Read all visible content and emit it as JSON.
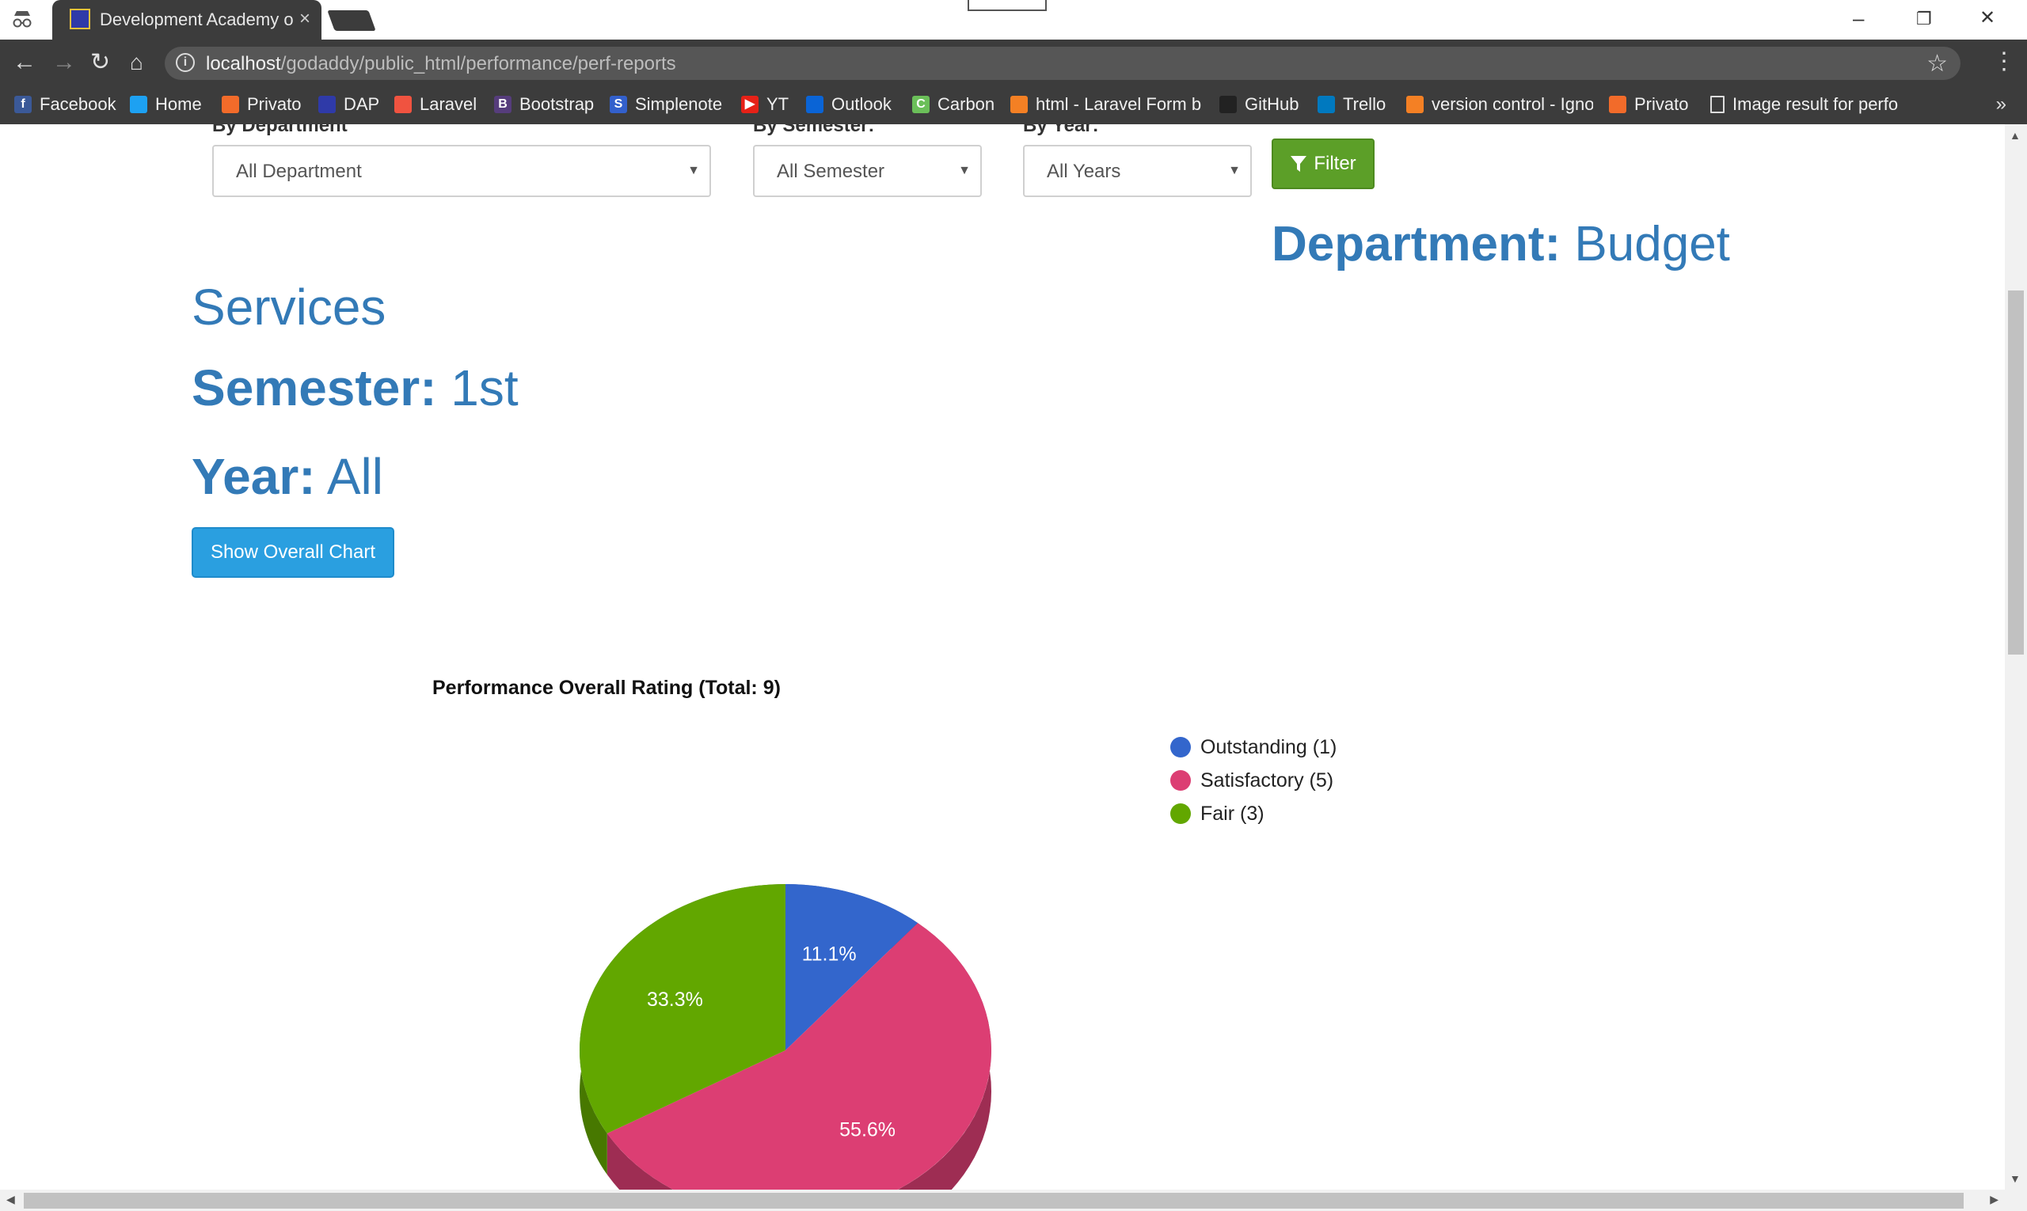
{
  "browser": {
    "tab_title": "Development Academy o",
    "new_tab": "new-tab",
    "url_host": "localhost",
    "url_path": "/godaddy/public_html/performance/perf-reports",
    "window_controls": {
      "minimize": "–",
      "restore": "❐",
      "close": "✕"
    },
    "bookmarks": [
      {
        "label": "Facebook",
        "icon": "facebook-icon",
        "color": "#3b5998",
        "glyph": "f"
      },
      {
        "label": "Home",
        "icon": "twitter-icon",
        "color": "#1da1f2",
        "glyph": ""
      },
      {
        "label": "Privato",
        "icon": "privato-icon",
        "color": "#f26b2a",
        "glyph": ""
      },
      {
        "label": "DAP",
        "icon": "dap-icon",
        "color": "#2f3aa8",
        "glyph": ""
      },
      {
        "label": "Laravel",
        "icon": "laravel-icon",
        "color": "#f05340",
        "glyph": ""
      },
      {
        "label": "Bootstrap",
        "icon": "bootstrap-icon",
        "color": "#563d7c",
        "glyph": "B"
      },
      {
        "label": "Simplenote",
        "icon": "simplenote-icon",
        "color": "#3360cc",
        "glyph": "S"
      },
      {
        "label": "YT",
        "icon": "youtube-icon",
        "color": "#e62117",
        "glyph": "▶"
      },
      {
        "label": "Outlook",
        "icon": "outlook-icon",
        "color": "#0a64d6",
        "glyph": ""
      },
      {
        "label": "Carbon",
        "icon": "carbon-icon",
        "color": "#6bbf59",
        "glyph": "C"
      },
      {
        "label": "html - Laravel Form b",
        "icon": "stackoverflow-icon",
        "color": "#f48024",
        "glyph": ""
      },
      {
        "label": "GitHub",
        "icon": "github-icon",
        "color": "#222222",
        "glyph": ""
      },
      {
        "label": "Trello",
        "icon": "trello-icon",
        "color": "#0079bf",
        "glyph": ""
      },
      {
        "label": "version control - Igno",
        "icon": "stackoverflow-icon",
        "color": "#f48024",
        "glyph": ""
      },
      {
        "label": "Privato",
        "icon": "privato-icon",
        "color": "#f26b2a",
        "glyph": ""
      },
      {
        "label": "Image result for perfo",
        "icon": "page-icon",
        "color": "#3c3c3c",
        "glyph": ""
      }
    ],
    "bookmarks_overflow": "»"
  },
  "filters": {
    "department_label": "By Department",
    "department_value": "All Department",
    "semester_label": "By Semester:",
    "semester_value": "All Semester",
    "year_label": "By Year:",
    "year_value": "All Years",
    "filter_button": "Filter"
  },
  "report": {
    "department_key": "Department:",
    "department_value": "Budget",
    "service": "Services",
    "semester_key": "Semester:",
    "semester_value": "1st",
    "year_key": "Year:",
    "year_value": "All",
    "overall_button": "Show Overall Chart"
  },
  "chart_data": {
    "type": "pie",
    "title": "Performance Overall Rating (Total: 9)",
    "slices": [
      {
        "name": "Outstanding",
        "value": 1,
        "percent_label": "11.1%",
        "legend": "Outstanding (1)",
        "color": "#3366cc"
      },
      {
        "name": "Satisfactory",
        "value": 5,
        "percent_label": "55.6%",
        "legend": "Satisfactory (5)",
        "color": "#dc3e73"
      },
      {
        "name": "Fair",
        "value": 3,
        "percent_label": "33.3%",
        "legend": "Fair (3)",
        "color": "#62a700"
      }
    ],
    "legend_position": "right",
    "style": "3d"
  }
}
